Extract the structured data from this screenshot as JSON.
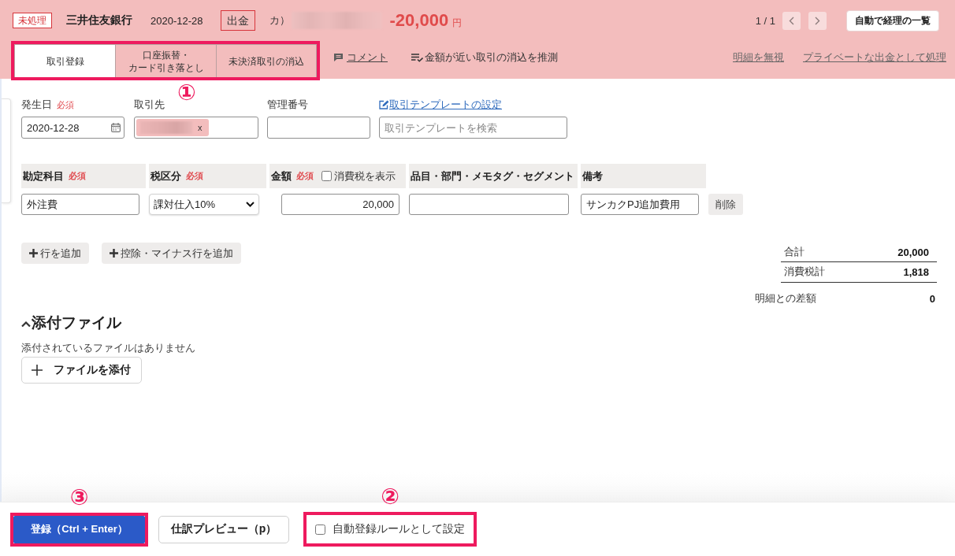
{
  "header": {
    "status_badge": "未処理",
    "bank": "三井住友銀行",
    "date": "2020-12-28",
    "direction_badge": "出金",
    "counterparty_prefix": "カ）",
    "amount": "-20,000",
    "currency": "円",
    "pager": "1 / 1",
    "list_button": "自動で経理の一覧"
  },
  "tab_bar": {
    "highlighted": true,
    "callout": "①",
    "tabs": [
      {
        "label": "取引登録",
        "selected": true
      },
      {
        "label": "口座振替・カード引き落とし",
        "selected": false
      },
      {
        "label": "未決済取引の消込",
        "selected": false
      }
    ]
  },
  "actions": [
    {
      "kind": "comment",
      "label": "コメント"
    },
    {
      "kind": "suggest",
      "label": "金額が近い取引の消込を推測"
    }
  ],
  "links": [
    "明細を無視",
    "プライベートな出金として処理"
  ],
  "form": {
    "fields": [
      {
        "kind": "date",
        "label": "発生日",
        "required": "必須",
        "value": "2020-12-28"
      },
      {
        "kind": "partner",
        "label": "取引先",
        "chip_remove": "x"
      },
      {
        "kind": "text",
        "label": "管理番号"
      },
      {
        "kind": "search",
        "link": "取引テンプレートの設定",
        "placeholder": "取引テンプレートを検索"
      }
    ]
  },
  "table": {
    "columns": [
      {
        "label": "勘定科目",
        "required": "必須"
      },
      {
        "label": "税区分",
        "required": "必須"
      },
      {
        "label": "金額",
        "required": "必須",
        "checkbox": {
          "label": "消費税を表示",
          "checked": false
        }
      },
      {
        "label": "品目・部門・メモタグ・セグメント"
      },
      {
        "label": "備考"
      }
    ],
    "rows": [
      {
        "cells": [
          {
            "kind": "text",
            "value": "外注費"
          },
          {
            "kind": "select",
            "value": "課対仕入10%"
          },
          {
            "kind": "amount",
            "value": "20,000"
          },
          {
            "kind": "text"
          },
          {
            "kind": "text",
            "value": "サンカクPJ追加費用"
          }
        ],
        "delete_button": "削除"
      }
    ]
  },
  "add_buttons": [
    "行を追加",
    "控除・マイナス行を追加"
  ],
  "totals": [
    {
      "kind": "subtotal",
      "label": "合計",
      "value": "20,000"
    },
    {
      "kind": "subtotal",
      "label": "消費税計",
      "value": "1,818"
    },
    {
      "kind": "difference",
      "label": "明細との差額",
      "value": "0"
    }
  ],
  "attachments": {
    "title": "添付ファイル",
    "expanded": true,
    "empty_text": "添付されているファイルはありません",
    "button": "ファイルを添付"
  },
  "footer": {
    "register_button": {
      "label": "登録（Ctrl + Enter）",
      "highlighted": true,
      "callout": "③"
    },
    "preview_button": "仕訳プレビュー（p）",
    "auto_rule": {
      "label": "自動登録ルールとして設定",
      "checked": false,
      "highlighted": true,
      "callout": "②"
    }
  }
}
